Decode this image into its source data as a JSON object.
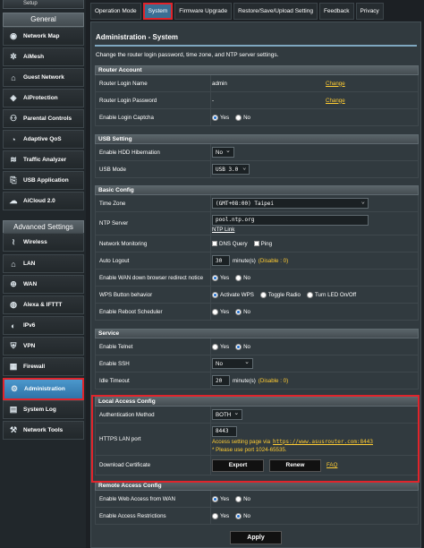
{
  "sidebar": {
    "setup_label": "Setup",
    "general_header": "General",
    "general_items": [
      {
        "label": "Network Map",
        "icon": "network-map-icon"
      },
      {
        "label": "AiMesh",
        "icon": "aimesh-icon"
      },
      {
        "label": "Guest Network",
        "icon": "guest-network-icon"
      },
      {
        "label": "AiProtection",
        "icon": "aiprotection-icon"
      },
      {
        "label": "Parental Controls",
        "icon": "parental-controls-icon"
      },
      {
        "label": "Adaptive QoS",
        "icon": "adaptive-qos-icon"
      },
      {
        "label": "Traffic Analyzer",
        "icon": "traffic-analyzer-icon"
      },
      {
        "label": "USB Application",
        "icon": "usb-icon"
      },
      {
        "label": "AiCloud 2.0",
        "icon": "cloud-icon"
      }
    ],
    "advanced_header": "Advanced Settings",
    "advanced_items": [
      {
        "label": "Wireless",
        "icon": "wireless-icon"
      },
      {
        "label": "LAN",
        "icon": "lan-icon"
      },
      {
        "label": "WAN",
        "icon": "wan-icon"
      },
      {
        "label": "Alexa & IFTTT",
        "icon": "alexa-icon"
      },
      {
        "label": "IPv6",
        "icon": "ipv6-icon"
      },
      {
        "label": "VPN",
        "icon": "vpn-icon"
      },
      {
        "label": "Firewall",
        "icon": "firewall-icon"
      },
      {
        "label": "Administration",
        "icon": "administration-icon"
      },
      {
        "label": "System Log",
        "icon": "system-log-icon"
      },
      {
        "label": "Network Tools",
        "icon": "network-tools-icon"
      }
    ]
  },
  "tabs": [
    "Operation Mode",
    "System",
    "Firmware Upgrade",
    "Restore/Save/Upload Setting",
    "Feedback",
    "Privacy"
  ],
  "page": {
    "title": "Administration - System",
    "description": "Change the router login password, time zone, and NTP server settings."
  },
  "router_account": {
    "header": "Router Account",
    "login_name_label": "Router Login Name",
    "login_name_value": "admin",
    "change_label": "Change",
    "login_password_label": "Router Login Password",
    "login_password_value": "-",
    "captcha_label": "Enable Login Captcha",
    "yes": "Yes",
    "no": "No"
  },
  "usb_setting": {
    "header": "USB Setting",
    "hdd_label": "Enable HDD Hibernation",
    "hdd_value": "No",
    "usb_mode_label": "USB Mode",
    "usb_mode_value": "USB 3.0"
  },
  "basic_config": {
    "header": "Basic Config",
    "time_zone_label": "Time Zone",
    "time_zone_value": "(GMT+08:00) Taipei",
    "ntp_label": "NTP Server",
    "ntp_value": "pool.ntp.org",
    "ntp_link": "NTP Link",
    "net_monitoring_label": "Network Monitoring",
    "dns_query": "DNS Query",
    "ping": "Ping",
    "auto_logout_label": "Auto Logout",
    "auto_logout_value": "30",
    "auto_logout_hint": "minute(s)",
    "auto_logout_disable": "(Disable : 0)",
    "wan_redirect_label": "Enable WAN down browser redirect notice",
    "wps_label": "WPS Button behavior",
    "wps_opt1": "Activate WPS",
    "wps_opt2": "Toggle Radio",
    "wps_opt3": "Turn LED On/Off",
    "reboot_label": "Enable Reboot Scheduler"
  },
  "service": {
    "header": "Service",
    "telnet_label": "Enable Telnet",
    "ssh_label": "Enable SSH",
    "ssh_value": "No",
    "idle_label": "Idle Timeout",
    "idle_value": "20",
    "idle_hint": "minute(s)",
    "idle_disable": "(Disable : 0)"
  },
  "local_access": {
    "header": "Local Access Config",
    "auth_label": "Authentication Method",
    "auth_value": "BOTH",
    "https_port_label": "HTTPS LAN port",
    "https_port_value": "8443",
    "access_text": "Access setting page via",
    "access_url": "https://www.asusrouter.com:8443",
    "port_note": "* Please use port 1024-65535.",
    "download_cert_label": "Download Certificate",
    "export_label": "Export",
    "renew_label": "Renew",
    "faq_label": "FAQ"
  },
  "remote_access": {
    "header": "Remote Access Config",
    "web_access_label": "Enable Web Access from WAN",
    "restrictions_label": "Enable Access Restrictions"
  },
  "apply_label": "Apply",
  "colors": {
    "accent_red": "#e0242b",
    "link_yellow": "#ffcc33",
    "active_blue": "#3a6e93"
  }
}
